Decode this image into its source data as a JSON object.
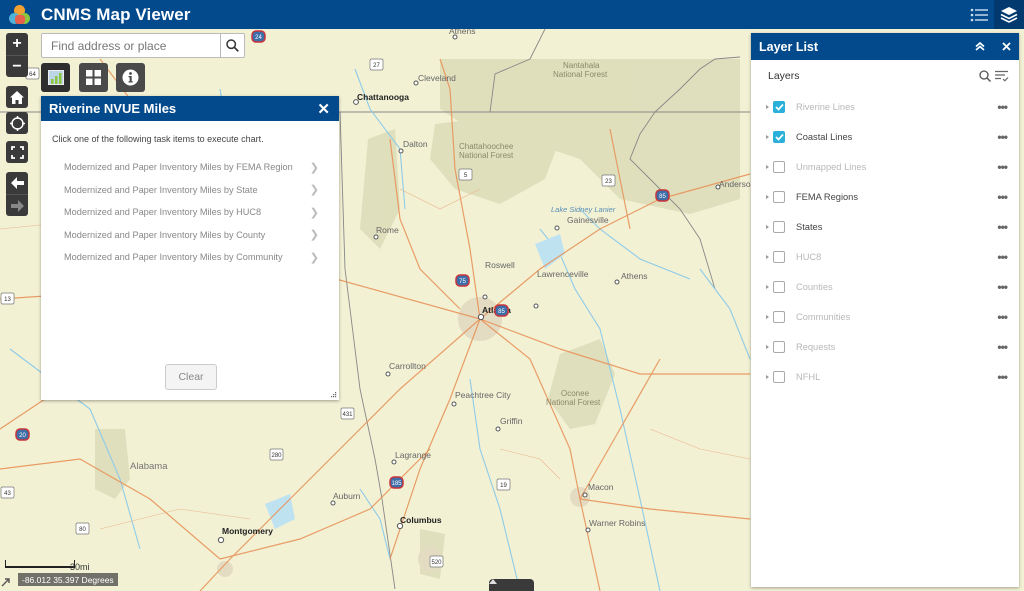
{
  "header": {
    "title": "CNMS Map Viewer",
    "icons": [
      "legend-list-icon",
      "layer-list-icon"
    ]
  },
  "search": {
    "placeholder": "Find address or place",
    "value": ""
  },
  "map": {
    "labels": [
      {
        "text": "Athens",
        "kind": "city"
      },
      {
        "text": "Cleveland",
        "kind": "city"
      },
      {
        "text": "Chattanooga",
        "kind": "major-city"
      },
      {
        "text": "Nantahala",
        "kind": "forest"
      },
      {
        "text": "National Forest",
        "kind": "forest"
      },
      {
        "text": "Chattahoochee",
        "kind": "forest"
      },
      {
        "text": "National Forest",
        "kind": "forest"
      },
      {
        "text": "Dalton",
        "kind": "city"
      },
      {
        "text": "Rome",
        "kind": "city"
      },
      {
        "text": "Roswell",
        "kind": "city"
      },
      {
        "text": "Lawrenceville",
        "kind": "city"
      },
      {
        "text": "Athens",
        "kind": "city"
      },
      {
        "text": "Gainesville",
        "kind": "city"
      },
      {
        "text": "Lake Sidney Lanier",
        "kind": "water"
      },
      {
        "text": "Anderson",
        "kind": "city"
      },
      {
        "text": "Atlanta",
        "kind": "major-city"
      },
      {
        "text": "Carrollton",
        "kind": "city"
      },
      {
        "text": "Peachtree City",
        "kind": "city"
      },
      {
        "text": "Griffin",
        "kind": "city"
      },
      {
        "text": "Oconee",
        "kind": "forest"
      },
      {
        "text": "National Forest",
        "kind": "forest"
      },
      {
        "text": "Lagrange",
        "kind": "city"
      },
      {
        "text": "Macon",
        "kind": "city"
      },
      {
        "text": "Warner Robins",
        "kind": "city"
      },
      {
        "text": "Alabama",
        "kind": "state"
      },
      {
        "text": "Auburn",
        "kind": "city"
      },
      {
        "text": "Montgomery",
        "kind": "major-city"
      },
      {
        "text": "Columbus",
        "kind": "major-city"
      }
    ],
    "shields": [
      "24",
      "27",
      "64",
      "5",
      "23",
      "85",
      "75",
      "85",
      "13",
      "431",
      "20",
      "280",
      "185",
      "43",
      "80",
      "19",
      "520"
    ],
    "scale_label": "30mi",
    "coordinates": "-86.012 35.397 Degrees"
  },
  "controls": {
    "zoom_in": "+",
    "zoom_out": "−"
  },
  "tools": [
    "chart-tool",
    "apps-tool",
    "info-tool"
  ],
  "riverine_panel": {
    "title": "Riverine NVUE Miles",
    "intro": "Click one of the following task items to execute chart.",
    "tasks": [
      "Modernized and Paper Inventory Miles by FEMA Region",
      "Modernized and Paper Inventory Miles by State",
      "Modernized and Paper Inventory Miles by HUC8",
      "Modernized and Paper Inventory Miles by County",
      "Modernized and Paper Inventory Miles by Community"
    ],
    "clear_label": "Clear"
  },
  "layer_list": {
    "title": "Layer List",
    "subheader": "Layers",
    "layers": [
      {
        "name": "Riverine Lines",
        "checked": true,
        "in_scale": false
      },
      {
        "name": "Coastal Lines",
        "checked": true,
        "in_scale": true
      },
      {
        "name": "Unmapped Lines",
        "checked": false,
        "in_scale": false
      },
      {
        "name": "FEMA Regions",
        "checked": false,
        "in_scale": true
      },
      {
        "name": "States",
        "checked": false,
        "in_scale": true
      },
      {
        "name": "HUC8",
        "checked": false,
        "in_scale": false
      },
      {
        "name": "Counties",
        "checked": false,
        "in_scale": false
      },
      {
        "name": "Communities",
        "checked": false,
        "in_scale": false
      },
      {
        "name": "Requests",
        "checked": false,
        "in_scale": false
      },
      {
        "name": "NFHL",
        "checked": false,
        "in_scale": false
      }
    ],
    "more_label": "•••"
  },
  "colors": {
    "brand": "#034a8c",
    "checkbox": "#2bb0d9",
    "map_base": "#f2f1d4",
    "forest": "#d9dab5",
    "road": "#e8935a",
    "water": "#a8d8ee"
  }
}
